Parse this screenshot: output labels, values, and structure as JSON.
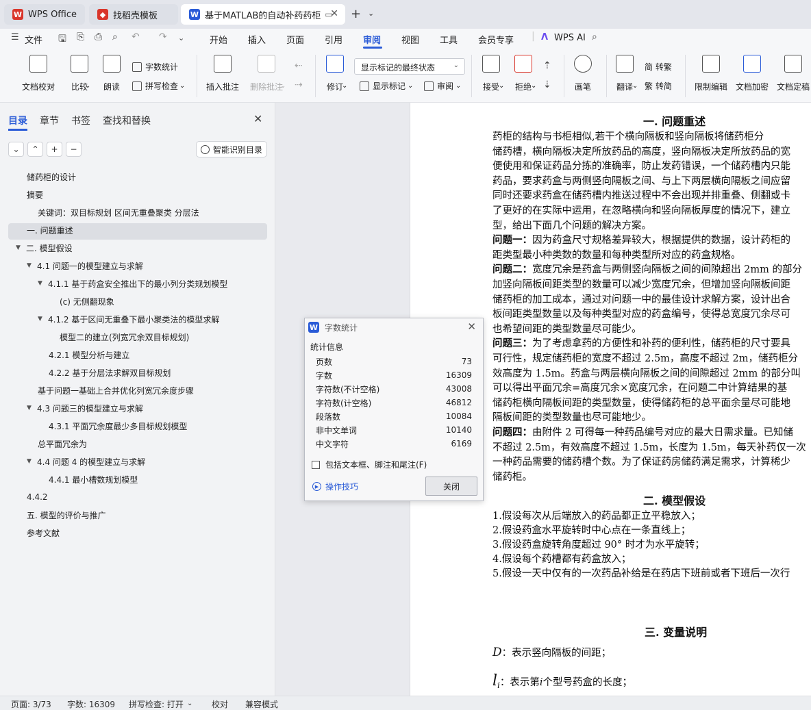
{
  "tabs": [
    {
      "label": "WPS Office",
      "icon": "wps-logo-icon",
      "color": "#d9362b"
    },
    {
      "label": "找稻壳模板",
      "icon": "docer-icon",
      "color": "#d9362b"
    },
    {
      "label": "基于MATLAB的自动补药药柜",
      "icon": "wps-writer-icon",
      "color": "#2a5bd7",
      "active": true
    }
  ],
  "new_tab": "+",
  "menu": {
    "file": "文件",
    "items": [
      "开始",
      "插入",
      "页面",
      "引用",
      "审阅",
      "视图",
      "工具",
      "会员专享"
    ],
    "active": "审阅",
    "ai": "WPS AI"
  },
  "ribbon": {
    "doc_proof": "文档校对",
    "compare": "比较",
    "read": "朗读",
    "word_count": "字数统计",
    "spell_check": "拼写检查",
    "insert_comment": "插入批注",
    "delete_comment": "删除批注",
    "revise": "修订",
    "markup_state": "显示标记的最终状态",
    "show_markup": "显示标记",
    "review": "审阅",
    "accept": "接受",
    "reject": "拒绝",
    "pen": "画笔",
    "translate": "翻译",
    "to_traditional": "简 转繁",
    "to_simplified": "繁 转简",
    "restrict_edit": "限制编辑",
    "doc_encrypt": "文档加密",
    "doc_finalize": "文档定稿"
  },
  "panel": {
    "tabs": [
      "目录",
      "章节",
      "书签",
      "查找和替换"
    ],
    "active_tab": "目录",
    "smart_toc": "智能识别目录",
    "toc": [
      {
        "label": "储药柜的设计",
        "level": 1,
        "arrow": ""
      },
      {
        "label": "摘要",
        "level": 1,
        "arrow": ""
      },
      {
        "label": "关键词：双目标规划 区间无重叠聚类 分层法",
        "level": 2,
        "arrow": ""
      },
      {
        "label": "一.  问题重述",
        "level": 1,
        "arrow": "",
        "selected": true
      },
      {
        "label": "二.  模型假设",
        "level": 1,
        "arrow": "▼"
      },
      {
        "label": "4.1  问题一的模型建立与求解",
        "level": 2,
        "arrow": "▼"
      },
      {
        "label": "4.1.1  基于药盒安全推出下的最小列分类规划模型",
        "level": 3,
        "arrow": "▼"
      },
      {
        "label": "(c)  无侧翻现象",
        "level": 4,
        "arrow": ""
      },
      {
        "label": "4.1.2     基于区间无重叠下最小聚类法的模型求解",
        "level": 3,
        "arrow": "▼"
      },
      {
        "label": "模型二的建立(列宽冗余双目标规划)",
        "level": 4,
        "arrow": ""
      },
      {
        "label": "4.2.1 模型分析与建立",
        "level": 3,
        "arrow": ""
      },
      {
        "label": "4.2.2  基于分层法求解双目标规划",
        "level": 3,
        "arrow": ""
      },
      {
        "label": "基于问题一基础上合并优化列宽冗余度步骤",
        "level": 2,
        "arrow": ""
      },
      {
        "label": "4.3  问题三的模型建立与求解",
        "level": 2,
        "arrow": "▼"
      },
      {
        "label": "4.3.1  平面冗余度最少多目标规划模型",
        "level": 3,
        "arrow": ""
      },
      {
        "label": "总平面冗余为",
        "level": 2,
        "arrow": ""
      },
      {
        "label": "4.4  问题 4 的模型建立与求解",
        "level": 2,
        "arrow": "▼"
      },
      {
        "label": "4.4.1  最小槽数规划模型",
        "level": 3,
        "arrow": ""
      },
      {
        "label": "4.4.2",
        "level": 1,
        "arrow": ""
      },
      {
        "label": "五.  模型的评价与推广",
        "level": 1,
        "arrow": ""
      },
      {
        "label": "参考文献",
        "level": 1,
        "arrow": ""
      }
    ]
  },
  "document": {
    "h1": "一.  问题重述",
    "lines": [
      {
        "pre": "",
        "bold": "",
        "text": "    药柜的结构与书柜相似,若干个横向隔板和竖向隔板将储药柜分"
      },
      {
        "pre": "",
        "bold": "",
        "text": "储药槽，横向隔板决定所放药品的高度，竖向隔板决定所放药品的宽"
      },
      {
        "pre": "",
        "bold": "",
        "text": "便使用和保证药品分拣的准确率，防止发药错误，一个储药槽内只能"
      },
      {
        "pre": "",
        "bold": "",
        "text": "药品，要求药盒与两侧竖向隔板之间、与上下两层横向隔板之间应留"
      },
      {
        "pre": "",
        "bold": "",
        "text": "同时还要求药盒在储药槽内推送过程中不会出现并排重叠、侧翻或卡"
      },
      {
        "pre": "",
        "bold": "",
        "text": "了更好的在实际中运用，在忽略横向和竖向隔板厚度的情况下，建立"
      },
      {
        "pre": "",
        "bold": "",
        "text": "型，给出下面几个问题的解决方案。"
      },
      {
        "pre": "",
        "bold": "问题一：",
        "text": "因为药盒尺寸规格差异较大，根据提供的数据，设计药柜的"
      },
      {
        "pre": "",
        "bold": "",
        "text": "距类型最小种类数的数量和每种类型所对应的药盒规格。"
      },
      {
        "pre": "",
        "bold": "问题二：",
        "text": "宽度冗余是药盒与两侧竖向隔板之间的间隙超出 2mm 的部分"
      },
      {
        "pre": "",
        "bold": "",
        "text": "加竖向隔板间距类型的数量可以减少宽度冗余，但增加竖向隔板间距"
      },
      {
        "pre": "",
        "bold": "",
        "text": "储药柜的加工成本，通过对问题一中的最佳设计求解方案，设计出合"
      },
      {
        "pre": "",
        "bold": "",
        "text": "板间距类型数量以及每种类型对应的药盒编号，使得总宽度冗余尽可"
      },
      {
        "pre": "",
        "bold": "",
        "text": "也希望间距的类型数量尽可能少。"
      },
      {
        "pre": "",
        "bold": "问题三：",
        "text": "为了考虑拿药的方便性和补药的便利性，储药柜的尺寸要具"
      },
      {
        "pre": "",
        "bold": "",
        "text": "可行性，规定储药柜的宽度不超过 2.5m，高度不超过 2m，储药柜分"
      },
      {
        "pre": "",
        "bold": "",
        "text": "效高度为 1.5m。药盒与两层横向隔板之间的间隙超过 2mm 的部分叫"
      },
      {
        "pre": "",
        "bold": "",
        "text": "可以得出平面冗余=高度冗余×宽度冗余，在问题二中计算结果的基"
      },
      {
        "pre": "",
        "bold": "",
        "text": "储药柜横向隔板间距的类型数量，使得储药柜的总平面余量尽可能地"
      },
      {
        "pre": "",
        "bold": "",
        "text": "隔板间距的类型数量也尽可能地少。"
      },
      {
        "pre": "",
        "bold": "问题四：",
        "text": "由附件 2 可得每一种药品编号对应的最大日需求量。已知储"
      },
      {
        "pre": "",
        "bold": "",
        "text": "不超过 2.5m，有效高度不超过 1.5m，长度为 1.5m，每天补药仅一次"
      },
      {
        "pre": "",
        "bold": "",
        "text": "一种药品需要的储药槽个数。为了保证药房储药满足需求，计算稀少"
      },
      {
        "pre": "",
        "bold": "",
        "text": "储药柜。"
      }
    ],
    "h2": "二.  模型假设",
    "assumptions": [
      "1.假设每次从后端放入的药品都正立平稳放入；",
      "2.假设药盒水平旋转时中心点在一条直线上；",
      "3.假设药盒旋转角度超过 90° 时才为水平旋转；",
      "4.假设每个药槽都有药盒放入；",
      "5.假设一天中仅有的一次药品补给是在药店下班前或者下班后一次行"
    ],
    "h3": "三.  变量说明",
    "var1_sym": "D",
    "var1_text": "：表示竖向隔板的间距；",
    "var2_sym": "l",
    "var2_sub": "i",
    "var2_pre": "：表示第",
    "var2_i": "i",
    "var2_post": "个型号药盒的长度；"
  },
  "dialog": {
    "title": "字数统计",
    "section": "统计信息",
    "stats": [
      {
        "label": "页数",
        "value": "73"
      },
      {
        "label": "字数",
        "value": "16309"
      },
      {
        "label": "字符数(不计空格)",
        "value": "43008"
      },
      {
        "label": "字符数(计空格)",
        "value": "46812"
      },
      {
        "label": "段落数",
        "value": "10084"
      },
      {
        "label": "非中文单词",
        "value": "10140"
      },
      {
        "label": "中文字符",
        "value": "6169"
      }
    ],
    "checkbox": "包括文本框、脚注和尾注(F)",
    "tips": "操作技巧",
    "close": "关闭"
  },
  "status": {
    "page": "页面: 3/73",
    "words": "字数: 16309",
    "spell": "拼写检查: 打开",
    "proof": "校对",
    "compat": "兼容模式"
  }
}
